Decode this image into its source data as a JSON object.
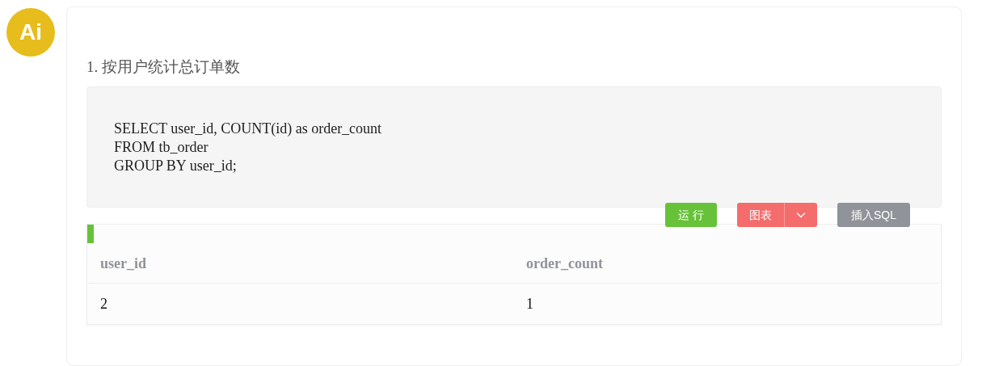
{
  "avatar": {
    "label": "Ai"
  },
  "heading": "1. 按用户统计总订单数",
  "code_lines": [
    "SELECT user_id, COUNT(id) as order_count",
    "FROM tb_order",
    "GROUP BY user_id;"
  ],
  "buttons": [
    {
      "kind": "run",
      "label": "运 行"
    },
    {
      "kind": "split",
      "label": "图表"
    },
    {
      "kind": "insert",
      "label": "插入SQL"
    }
  ],
  "table": {
    "columns": [
      "user_id",
      "order_count"
    ],
    "rows": [
      [
        "2",
        "1"
      ]
    ]
  }
}
